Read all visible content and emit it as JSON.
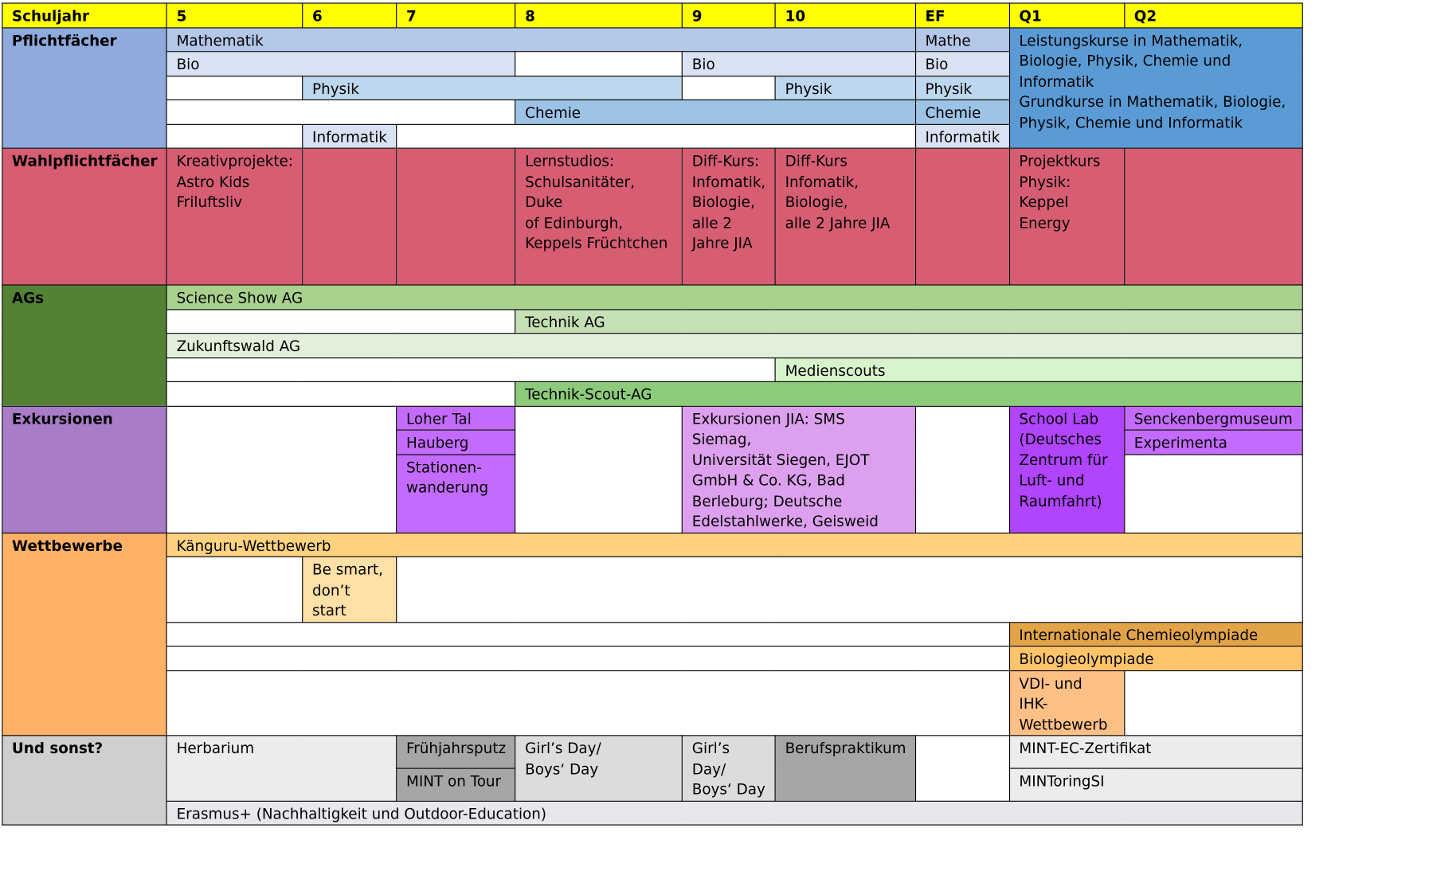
{
  "header": [
    "Schuljahr",
    "5",
    "6",
    "7",
    "8",
    "9",
    "10",
    "EF",
    "Q1",
    "Q2"
  ],
  "sections": {
    "pflicht": {
      "label": "Pflichtfächer",
      "mathematik": "Mathematik",
      "mathe_ef": "Mathe",
      "q_text": "Leistungskurse in Mathematik,\nBiologie, Physik, Chemie und\nInformatik\nGrundkurse in Mathematik, Biologie,\nPhysik, Chemie und Informatik",
      "bio": "Bio",
      "bio9": "Bio",
      "bio_ef": "Bio",
      "physik": "Physik",
      "physik10": "Physik",
      "physik_ef": "Physik",
      "chemie": "Chemie",
      "chemie_ef": "Chemie",
      "informatik": "Informatik",
      "informatik_ef": "Informatik"
    },
    "wahl": {
      "label": "Wahlpflichtfächer",
      "c5": "Kreativprojekte:\nAstro Kids\nFriluftsliv",
      "c8": "Lernstudios:\nSchulsanitäter, Duke\nof Edinburgh,\nKeppels Früchtchen",
      "c9": "Diff-Kurs:\nInfomatik,\nBiologie,\nalle 2\nJahre JIA",
      "c10": "Diff-Kurs\nInfomatik,\nBiologie,\nalle 2 Jahre JIA",
      "q1": "Projektkurs\nPhysik:\nKeppel\nEnergy"
    },
    "ags": {
      "label": "AGs",
      "science": "Science Show AG",
      "technik": "Technik AG",
      "zukunft": "Zukunftswald AG",
      "medien": "Medienscouts",
      "scout": "Technik-Scout-AG"
    },
    "exk": {
      "label": "Exkursionen",
      "loher": "Loher Tal",
      "hauberg": "Hauberg",
      "stationen": "Stationen-\nwanderung",
      "jia": "Exkursionen JIA: SMS Siemag,\nUniversität Siegen, EJOT\nGmbH & Co. KG, Bad\nBerleburg; Deutsche\nEdelstahlwerke, Geisweid",
      "schoollab": "School Lab\n(Deutsches\nZentrum für\nLuft- und\nRaumfahrt)",
      "senckenberg": "Senckenbergmuseum",
      "experimenta": "Experimenta"
    },
    "wett": {
      "label": "Wettbewerbe",
      "kaenguru": "Känguru-Wettbewerb",
      "besmart": "Be smart,\ndon’t start",
      "chemieolymp": "Internationale Chemieolympiade",
      "bioolymp": "Biologieolympiade",
      "vdi": "VDI- und IHK-\nWettbewerb"
    },
    "sonst": {
      "label": "Und sonst?",
      "herbarium": "Herbarium",
      "fruehjahr": "Frühjahrsputz",
      "mint_tour": "MINT on Tour",
      "girls8": "Girl’s Day/\nBoys‘ Day",
      "girls9": "Girl’s Day/\nBoys‘ Day",
      "beruf": "Berufspraktikum",
      "mintec": "MINT-EC-Zertifikat",
      "mintoring": "MINToringSI",
      "erasmus": "Erasmus+ (Nachhaltigkeit und Outdoor-Education)"
    }
  }
}
